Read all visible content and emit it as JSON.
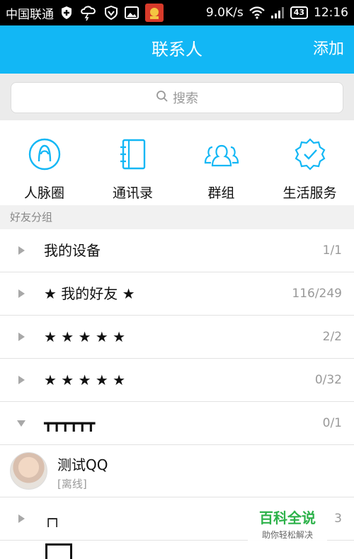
{
  "status_bar": {
    "carrier": "中国联通",
    "speed": "9.0K/s",
    "battery": "43",
    "time": "12:16"
  },
  "header": {
    "title": "联系人",
    "add_label": "添加"
  },
  "search": {
    "placeholder": "搜索"
  },
  "quick_actions": [
    {
      "label": "人脉圈",
      "icon": "person-circle-icon"
    },
    {
      "label": "通讯录",
      "icon": "address-book-icon"
    },
    {
      "label": "群组",
      "icon": "group-icon"
    },
    {
      "label": "生活服务",
      "icon": "service-badge-icon"
    }
  ],
  "section": {
    "title": "好友分组"
  },
  "groups": [
    {
      "name": "我的设备",
      "count": "1/1",
      "expanded": false
    },
    {
      "name": "★ 我的好友 ★",
      "count": "116/249",
      "expanded": false
    },
    {
      "name": " ★ ★ ★ ★ ★",
      "count": "2/2",
      "expanded": false
    },
    {
      "name": " ★ ★ ★ ★ ★",
      "count": "0/32",
      "expanded": false
    },
    {
      "name": "┳┳┳┳┳┳",
      "count": "0/1",
      "expanded": true
    }
  ],
  "contact": {
    "name": "测试QQ",
    "status": "[离线]"
  },
  "group_after": {
    "name": "┌┐",
    "count": "3"
  },
  "watermark": {
    "title": "百科全说",
    "subtitle": "助你轻松解决"
  },
  "colors": {
    "accent": "#12b7f5",
    "status_bar": "#000000"
  }
}
